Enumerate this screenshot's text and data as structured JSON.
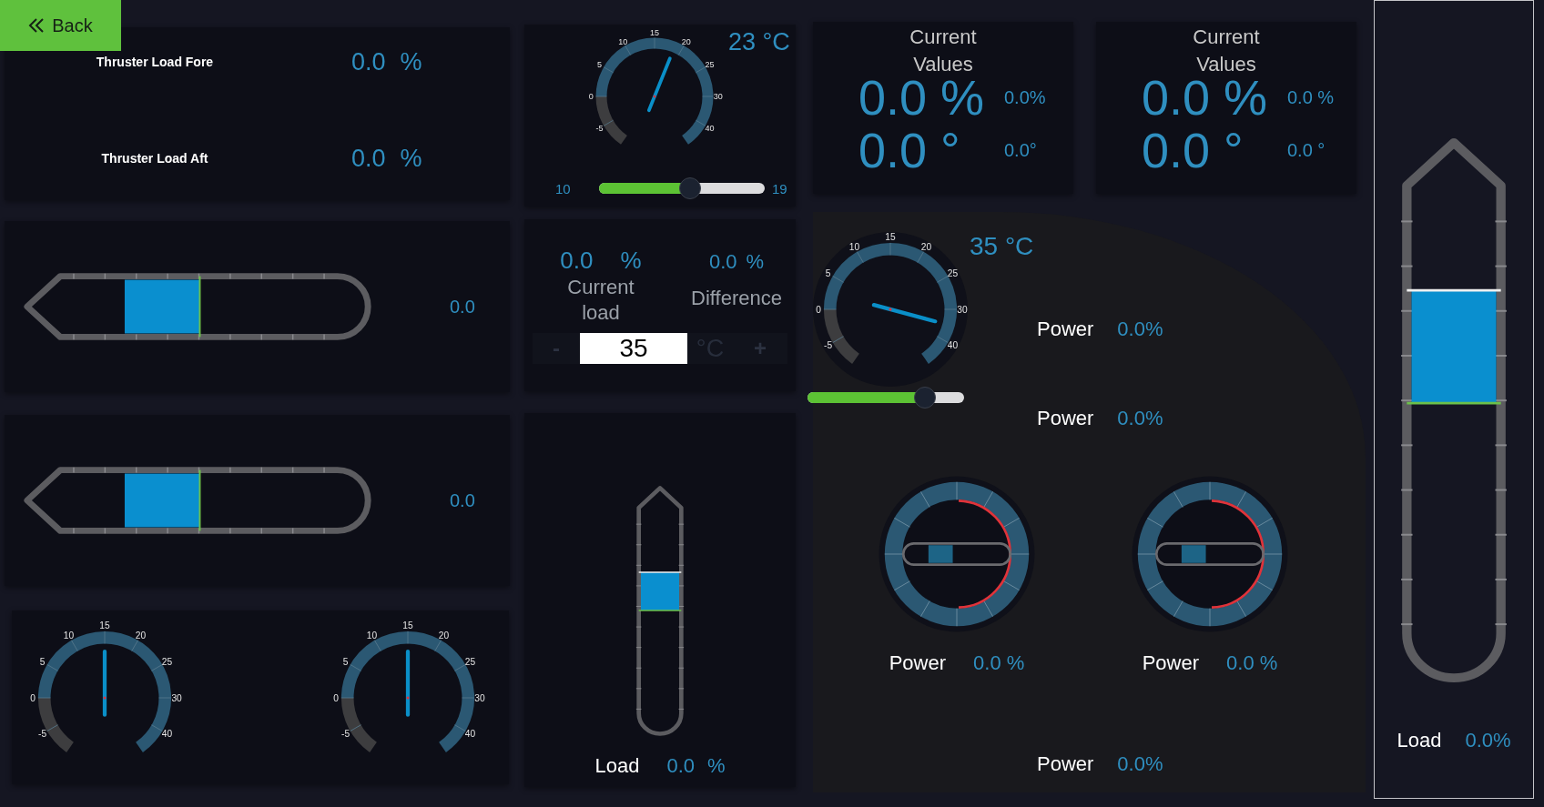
{
  "back_button": {
    "label": "Back"
  },
  "thruster_loads": [
    {
      "label": "Thruster Load Fore",
      "value": "0.0",
      "unit": "%"
    },
    {
      "label": "Thruster Load Aft",
      "value": "0.0",
      "unit": "%"
    }
  ],
  "tank_bars": [
    {
      "value": "0.0"
    },
    {
      "value": "0.0"
    }
  ],
  "bottom_gauges": [
    {
      "ticks": [
        "-5",
        "0",
        "5",
        "10",
        "15",
        "20",
        "25",
        "30",
        "40"
      ]
    },
    {
      "ticks": [
        "-5",
        "0",
        "5",
        "10",
        "15",
        "20",
        "25",
        "30",
        "40"
      ]
    }
  ],
  "temperature_gauge": {
    "reading": "23 °C",
    "ticks": [
      "-5",
      "0",
      "5",
      "10",
      "15",
      "20",
      "25",
      "30",
      "40"
    ],
    "min_label": "10",
    "max_label": "19",
    "slider": {
      "level": 0.55
    }
  },
  "load_summary": {
    "current": {
      "value": "0.0",
      "unit": "%",
      "label": "Current load"
    },
    "difference": {
      "value": "0.0",
      "unit": "%",
      "label": "Difference"
    },
    "stepper": {
      "minus": "-",
      "value": "35",
      "unit": "°C",
      "plus": "+"
    }
  },
  "vertical_tank": {
    "label": "Load",
    "value": "0.0",
    "unit": "%"
  },
  "current_values_cards": [
    {
      "title": "Current Values",
      "primary": "0.0 %",
      "primary_small": "0.0%",
      "secondary": "0.0 °",
      "secondary_small": "0.0°"
    },
    {
      "title": "Current Values",
      "primary": "0.0 %",
      "primary_small": "0.0 %",
      "secondary": "0.0 °",
      "secondary_small": "0.0 °"
    }
  ],
  "power_panel": {
    "gauge": {
      "reading": "35 °C",
      "ticks": [
        "-5",
        "0",
        "5",
        "10",
        "15",
        "20",
        "25",
        "30",
        "40"
      ],
      "slider": {
        "level": 0.75
      }
    },
    "power_rows": [
      {
        "label": "Power",
        "value": "0.0%"
      },
      {
        "label": "Power",
        "value": "0.0%"
      }
    ],
    "ring_gauges": [
      {
        "label": "Power",
        "value": "0.0 %"
      },
      {
        "label": "Power",
        "value": "0.0 %"
      }
    ],
    "footer": {
      "label": "Power",
      "value": "0.0%"
    }
  },
  "side_tank": {
    "label": "Load",
    "value": "0.0%"
  }
}
